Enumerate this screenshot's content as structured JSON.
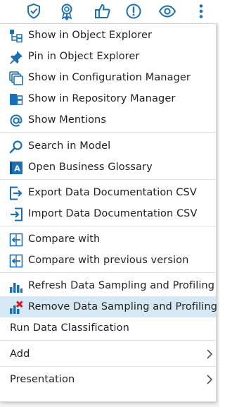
{
  "toolbar": {
    "icons": [
      "shield-check-icon",
      "award-ribbon-icon",
      "thumbs-up-icon",
      "alert-circle-icon",
      "eye-icon",
      "more-vertical-icon"
    ],
    "accent": "#1a6fb6"
  },
  "menu": {
    "items": {
      "show_object_explorer": "Show in Object Explorer",
      "pin_object_explorer": "Pin in Object Explorer",
      "show_config_manager": "Show in Configuration Manager",
      "show_repo_manager": "Show in Repository Manager",
      "show_mentions": "Show Mentions",
      "search_model": "Search in Model",
      "open_glossary": "Open Business Glossary",
      "export_csv": "Export Data Documentation CSV",
      "import_csv": "Import Data Documentation CSV",
      "compare_with": "Compare with",
      "compare_previous": "Compare with previous version",
      "refresh_sampling": "Refresh Data Sampling and Profiling",
      "remove_sampling": "Remove Data Sampling and Profiling",
      "run_classification": "Run Data Classification",
      "add": "Add",
      "presentation": "Presentation"
    },
    "selected_item": "Remove Data Sampling and Profiling",
    "highlight_color": "#d7e8f5"
  }
}
